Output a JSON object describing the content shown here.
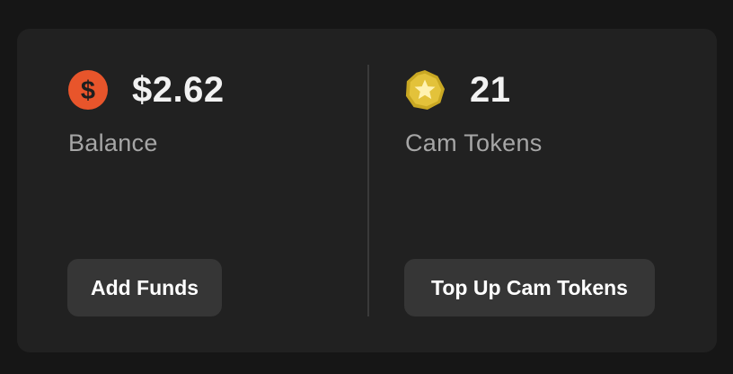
{
  "balance": {
    "value": "$2.62",
    "label": "Balance",
    "icon": "dollar-coin-icon",
    "button_label": "Add Funds"
  },
  "tokens": {
    "value": "21",
    "label": "Cam Tokens",
    "icon": "star-token-icon",
    "button_label": "Top Up Cam Tokens"
  },
  "colors": {
    "background": "#161616",
    "card": "#212121",
    "button": "#363636",
    "dollar_icon": "#e8552b",
    "token_icon": "#e3c23a"
  }
}
